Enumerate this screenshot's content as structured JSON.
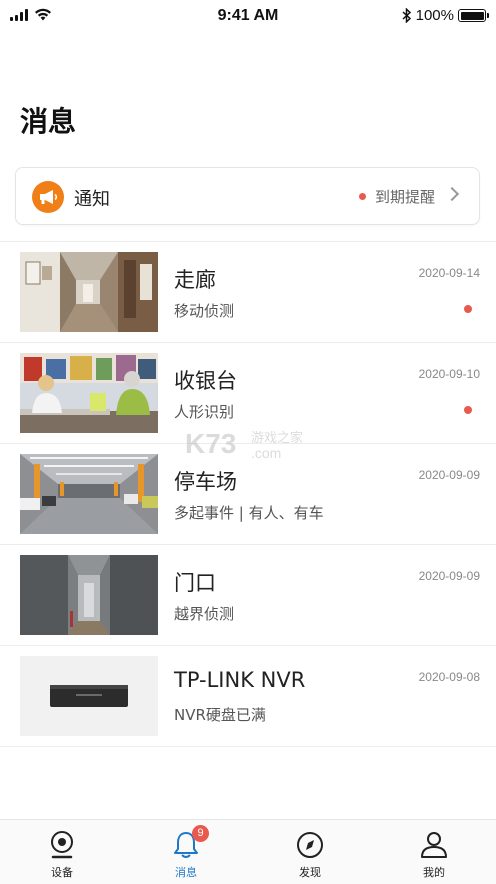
{
  "status_bar": {
    "time": "9:41 AM",
    "battery": "100%"
  },
  "title": "消息",
  "notice": {
    "label": "通知",
    "reminder": "到期提醒"
  },
  "messages": [
    {
      "title": "走廊",
      "subtitle": "移动侦测",
      "date": "2020-09-14",
      "unread": true,
      "thumb": "corridor"
    },
    {
      "title": "收银台",
      "subtitle": "人形识别",
      "date": "2020-09-10",
      "unread": true,
      "thumb": "cashier"
    },
    {
      "title": "停车场",
      "subtitle": "多起事件 | 有人、有车",
      "date": "2020-09-09",
      "unread": false,
      "thumb": "parking"
    },
    {
      "title": "门口",
      "subtitle": "越界侦测",
      "date": "2020-09-09",
      "unread": false,
      "thumb": "doorway"
    },
    {
      "title": "TP-LINK NVR",
      "subtitle": "NVR硬盘已满",
      "date": "2020-09-08",
      "unread": false,
      "thumb": "nvr"
    }
  ],
  "tabs": [
    {
      "label": "设备",
      "icon": "camera-icon",
      "active": false
    },
    {
      "label": "消息",
      "icon": "bell-icon",
      "active": true,
      "badge": "9"
    },
    {
      "label": "发现",
      "icon": "compass-icon",
      "active": false
    },
    {
      "label": "我的",
      "icon": "person-icon",
      "active": false
    }
  ],
  "colors": {
    "accent": "#1e78c8",
    "notice_icon": "#f07f17",
    "unread_dot": "#e85a4f"
  },
  "watermark": {
    "brand": "K73",
    "text": "游戏之家",
    "domain": ".com"
  }
}
